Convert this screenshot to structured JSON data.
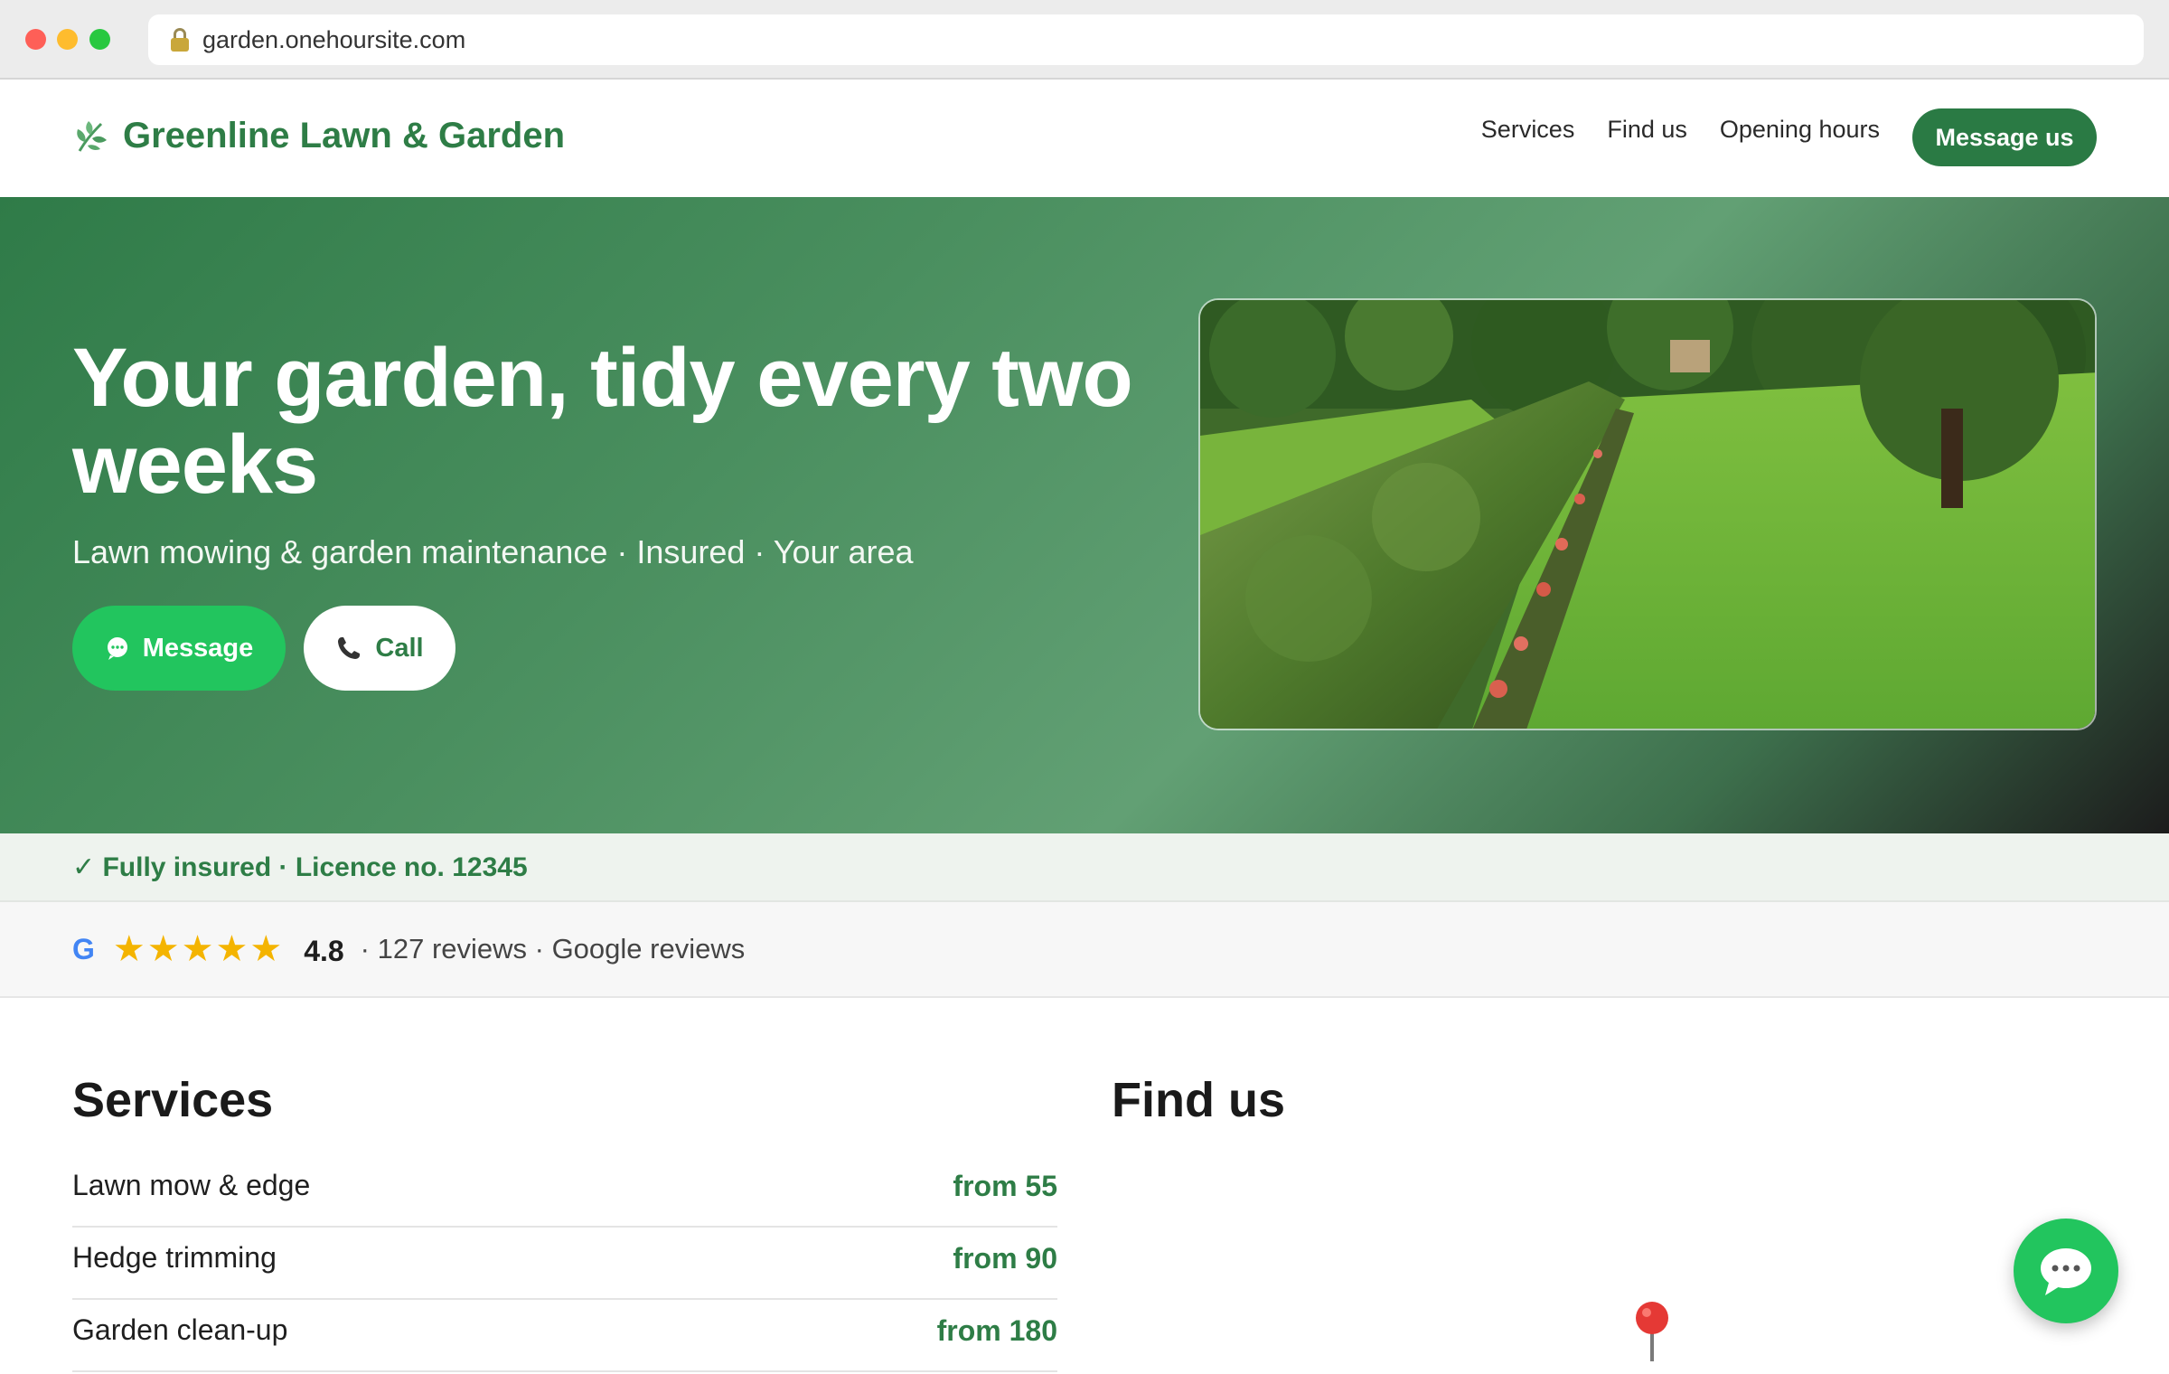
{
  "browser": {
    "url": "garden.onehoursite.com"
  },
  "header": {
    "brand": "Greenline Lawn & Garden",
    "nav": [
      {
        "label": "Services"
      },
      {
        "label": "Find us"
      },
      {
        "label": "Opening hours"
      }
    ],
    "cta_label": "Message us"
  },
  "hero": {
    "title": "Your garden, tidy every two weeks",
    "subtitle": "Lawn mowing & garden maintenance · Insured · Your area",
    "message_label": "Message",
    "call_label": "Call"
  },
  "insured": {
    "text": "✓ Fully insured · Licence no. 12345"
  },
  "reviews": {
    "source_letter": "G",
    "stars": "★★★★★",
    "rating": "4.8",
    "meta": "· 127 reviews · Google reviews"
  },
  "services": {
    "title": "Services",
    "items": [
      {
        "name": "Lawn mow & edge",
        "price": "from 55"
      },
      {
        "name": "Hedge trimming",
        "price": "from 90"
      },
      {
        "name": "Garden clean-up",
        "price": "from 180"
      }
    ]
  },
  "findus": {
    "title": "Find us"
  },
  "colors": {
    "brand_green": "#2e7d46",
    "whatsapp_green": "#22c55e",
    "star_yellow": "#f4b400"
  },
  "icons": {
    "logo": "leaf-icon",
    "message": "chat-bubble-icon",
    "call": "phone-icon",
    "map": "map-pin-icon",
    "fab": "chat-bubble-icon"
  }
}
